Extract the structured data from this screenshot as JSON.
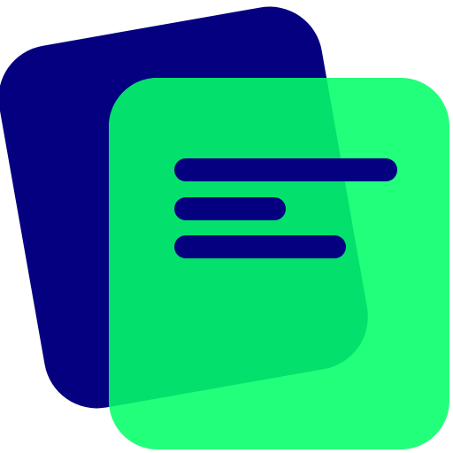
{
  "icon": {
    "name": "notes-app-icon",
    "colors": {
      "back_sheet": "#050080",
      "front_sheet": "#22FF7A",
      "overlap": "#03E06C",
      "text_lines": "#050080",
      "background": "#FFFFFF"
    },
    "text_line_count": 3
  }
}
